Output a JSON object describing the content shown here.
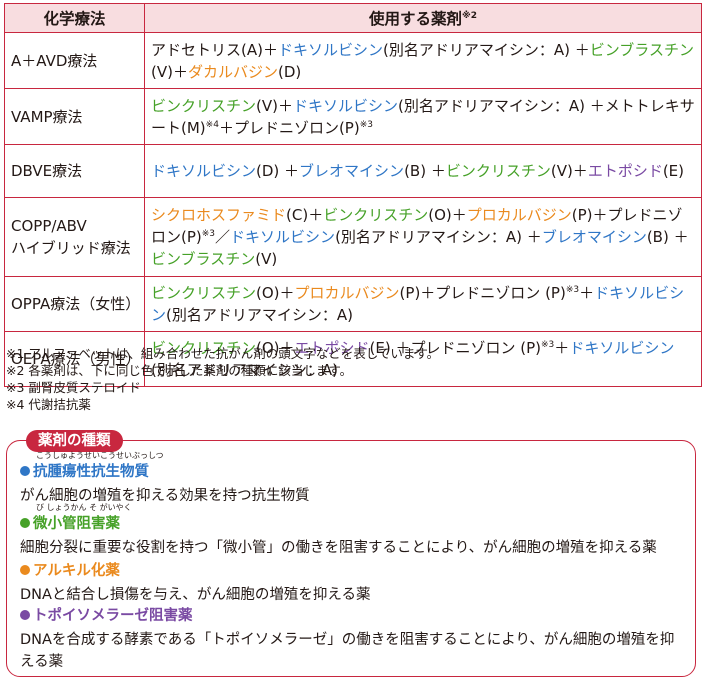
{
  "table": {
    "headers": {
      "regimen": "化学療法",
      "drugs": "使用する薬剤",
      "drugs_note": "※2"
    },
    "rows": [
      {
        "name": "A＋AVD療法",
        "drugs": [
          {
            "t": "アドセトリス(A)＋",
            "c": "black"
          },
          {
            "t": "ドキソルビシン",
            "c": "blue"
          },
          {
            "t": "(別名アドリアマイシン：A) ＋",
            "c": "black"
          },
          {
            "t": "ビンブラスチン",
            "c": "green"
          },
          {
            "t": "(V)＋",
            "c": "black"
          },
          {
            "t": "ダカルバジン",
            "c": "orange"
          },
          {
            "t": "(D)",
            "c": "black"
          }
        ]
      },
      {
        "name": "VAMP療法",
        "drugs": [
          {
            "t": "ビンクリスチン",
            "c": "green"
          },
          {
            "t": "(V)＋",
            "c": "black"
          },
          {
            "t": "ドキソルビシン",
            "c": "blue"
          },
          {
            "t": "(別名アドリアマイシン：A) ＋メトトレキサート(M)",
            "c": "black"
          },
          {
            "t": "※4",
            "c": "black",
            "sup": true
          },
          {
            "t": "＋プレドニゾロン(P)",
            "c": "black"
          },
          {
            "t": "※3",
            "c": "black",
            "sup": true
          }
        ]
      },
      {
        "name": "DBVE療法",
        "drugs": [
          {
            "t": "ドキソルビシン",
            "c": "blue"
          },
          {
            "t": "(D) ＋",
            "c": "black"
          },
          {
            "t": "ブレオマイシン",
            "c": "blue"
          },
          {
            "t": "(B) ＋",
            "c": "black"
          },
          {
            "t": "ビンクリスチン",
            "c": "green"
          },
          {
            "t": "(V)＋",
            "c": "black"
          },
          {
            "t": "エトポシド",
            "c": "purple"
          },
          {
            "t": "(E)",
            "c": "black"
          }
        ]
      },
      {
        "name": "COPP/ABV\nハイブリッド療法",
        "drugs": [
          {
            "t": "シクロホスファミド",
            "c": "orange"
          },
          {
            "t": "(C)＋",
            "c": "black"
          },
          {
            "t": "ビンクリスチン",
            "c": "green"
          },
          {
            "t": "(O)＋",
            "c": "black"
          },
          {
            "t": "プロカルバジン",
            "c": "orange"
          },
          {
            "t": "(P)＋プレドニゾロン(P)",
            "c": "black"
          },
          {
            "t": "※3",
            "c": "black",
            "sup": true
          },
          {
            "t": "／",
            "c": "black"
          },
          {
            "t": "ドキソルビシン",
            "c": "blue"
          },
          {
            "t": "(別名アドリアマイシン：A) ＋",
            "c": "black"
          },
          {
            "t": "ブレオマイシン",
            "c": "blue"
          },
          {
            "t": "(B) ＋",
            "c": "black"
          },
          {
            "t": "ビンブラスチン",
            "c": "green"
          },
          {
            "t": "(V)",
            "c": "black"
          }
        ]
      },
      {
        "name": "OPPA療法（女性）",
        "drugs": [
          {
            "t": "ビンクリスチン",
            "c": "green"
          },
          {
            "t": "(O)＋",
            "c": "black"
          },
          {
            "t": "プロカルバジン",
            "c": "orange"
          },
          {
            "t": "(P)＋プレドニゾロン (P)",
            "c": "black"
          },
          {
            "t": "※3",
            "c": "black",
            "sup": true
          },
          {
            "t": "＋",
            "c": "black"
          },
          {
            "t": "ドキソルビシン",
            "c": "blue"
          },
          {
            "t": "(別名アドリアマイシン：A)",
            "c": "black"
          }
        ]
      },
      {
        "name": "OEPA療法（男性）",
        "drugs": [
          {
            "t": "ビンクリスチン",
            "c": "green"
          },
          {
            "t": "(O)＋",
            "c": "black"
          },
          {
            "t": "エトポシド",
            "c": "purple"
          },
          {
            "t": "(E)  ＋プレドニゾロン (P)",
            "c": "black"
          },
          {
            "t": "※3",
            "c": "black",
            "sup": true
          },
          {
            "t": "＋",
            "c": "black"
          },
          {
            "t": "ドキソルビシン",
            "c": "blue"
          },
          {
            "t": "(別名アドリアマイシン：A)",
            "c": "black"
          }
        ]
      }
    ]
  },
  "notes": [
    "※1 アルファベットは、組み合わせた抗がん剤の頭文字などを表しています。",
    "※2 各薬剤は、下に同じ色で示した薬剤の種類に該当します。",
    "※3 副腎皮質ステロイド",
    "※4 代謝拮抗薬"
  ],
  "categories_box": {
    "title": "薬剤の種類",
    "items": [
      {
        "name": "抗腫瘍性抗生物質",
        "ruby": "こうしゅようせいこうせいぶっしつ",
        "desc": "がん細胞の増殖を抑える効果を持つ抗生物質",
        "color": "#2f76c6"
      },
      {
        "name": "微小管阻害薬",
        "ruby": "び しょうかん そ がいやく",
        "desc": "細胞分裂に重要な役割を持つ「微小管」の働きを阻害することにより、がん細胞の増殖を抑える薬",
        "color": "#46a128"
      },
      {
        "name": "アルキル化薬",
        "ruby": "",
        "desc": "DNAと結合し損傷を与え、がん細胞の増殖を抑える薬",
        "color": "#ea8a1e"
      },
      {
        "name": "トポイソメラーゼ阻害薬",
        "ruby": "",
        "desc": "DNAを合成する酵素である「トポイソメラーゼ」の働きを阻害することにより、がん細胞の増殖を抑える薬",
        "color": "#7a4aa3"
      }
    ]
  },
  "colors": {
    "border": "#c8273f",
    "header_bg": "#f8dde0",
    "green": "#46a128",
    "blue": "#2f76c6",
    "orange": "#ea8a1e",
    "purple": "#7a4aa3"
  }
}
